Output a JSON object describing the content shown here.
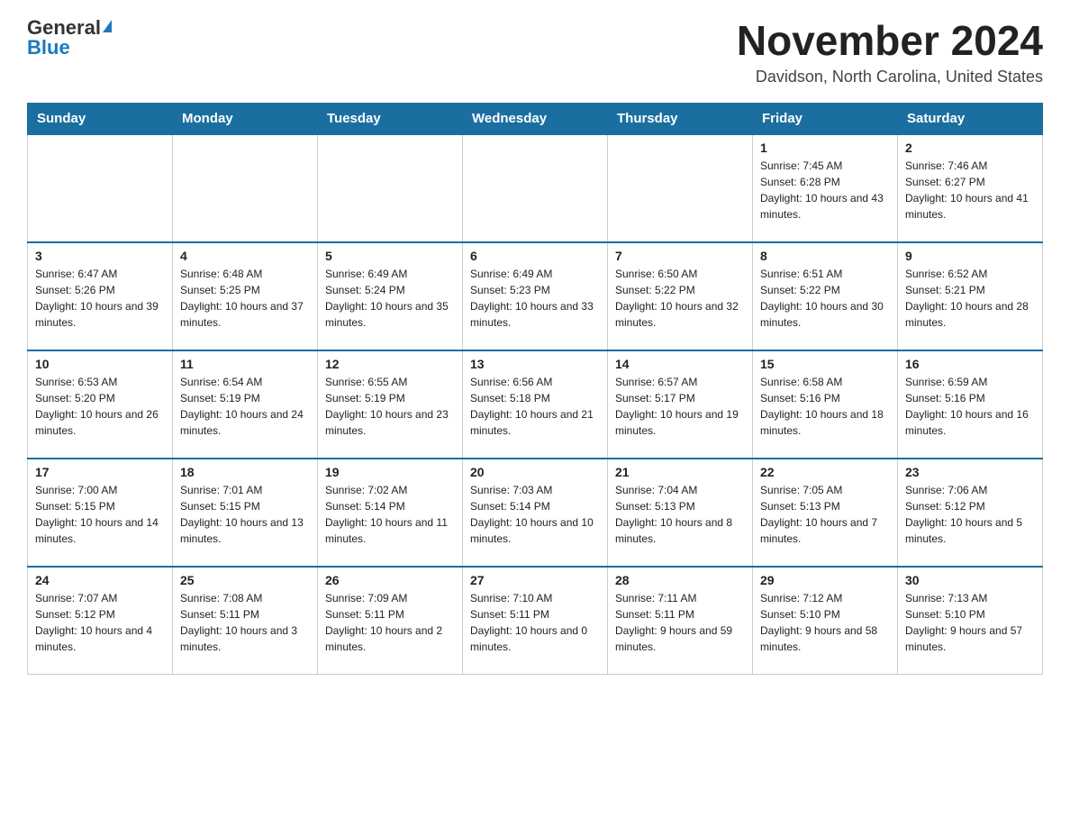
{
  "logo": {
    "general": "General",
    "blue": "Blue"
  },
  "title": {
    "month": "November 2024",
    "location": "Davidson, North Carolina, United States"
  },
  "weekdays": [
    "Sunday",
    "Monday",
    "Tuesday",
    "Wednesday",
    "Thursday",
    "Friday",
    "Saturday"
  ],
  "weeks": [
    [
      {
        "day": "",
        "info": ""
      },
      {
        "day": "",
        "info": ""
      },
      {
        "day": "",
        "info": ""
      },
      {
        "day": "",
        "info": ""
      },
      {
        "day": "",
        "info": ""
      },
      {
        "day": "1",
        "info": "Sunrise: 7:45 AM\nSunset: 6:28 PM\nDaylight: 10 hours and 43 minutes."
      },
      {
        "day": "2",
        "info": "Sunrise: 7:46 AM\nSunset: 6:27 PM\nDaylight: 10 hours and 41 minutes."
      }
    ],
    [
      {
        "day": "3",
        "info": "Sunrise: 6:47 AM\nSunset: 5:26 PM\nDaylight: 10 hours and 39 minutes."
      },
      {
        "day": "4",
        "info": "Sunrise: 6:48 AM\nSunset: 5:25 PM\nDaylight: 10 hours and 37 minutes."
      },
      {
        "day": "5",
        "info": "Sunrise: 6:49 AM\nSunset: 5:24 PM\nDaylight: 10 hours and 35 minutes."
      },
      {
        "day": "6",
        "info": "Sunrise: 6:49 AM\nSunset: 5:23 PM\nDaylight: 10 hours and 33 minutes."
      },
      {
        "day": "7",
        "info": "Sunrise: 6:50 AM\nSunset: 5:22 PM\nDaylight: 10 hours and 32 minutes."
      },
      {
        "day": "8",
        "info": "Sunrise: 6:51 AM\nSunset: 5:22 PM\nDaylight: 10 hours and 30 minutes."
      },
      {
        "day": "9",
        "info": "Sunrise: 6:52 AM\nSunset: 5:21 PM\nDaylight: 10 hours and 28 minutes."
      }
    ],
    [
      {
        "day": "10",
        "info": "Sunrise: 6:53 AM\nSunset: 5:20 PM\nDaylight: 10 hours and 26 minutes."
      },
      {
        "day": "11",
        "info": "Sunrise: 6:54 AM\nSunset: 5:19 PM\nDaylight: 10 hours and 24 minutes."
      },
      {
        "day": "12",
        "info": "Sunrise: 6:55 AM\nSunset: 5:19 PM\nDaylight: 10 hours and 23 minutes."
      },
      {
        "day": "13",
        "info": "Sunrise: 6:56 AM\nSunset: 5:18 PM\nDaylight: 10 hours and 21 minutes."
      },
      {
        "day": "14",
        "info": "Sunrise: 6:57 AM\nSunset: 5:17 PM\nDaylight: 10 hours and 19 minutes."
      },
      {
        "day": "15",
        "info": "Sunrise: 6:58 AM\nSunset: 5:16 PM\nDaylight: 10 hours and 18 minutes."
      },
      {
        "day": "16",
        "info": "Sunrise: 6:59 AM\nSunset: 5:16 PM\nDaylight: 10 hours and 16 minutes."
      }
    ],
    [
      {
        "day": "17",
        "info": "Sunrise: 7:00 AM\nSunset: 5:15 PM\nDaylight: 10 hours and 14 minutes."
      },
      {
        "day": "18",
        "info": "Sunrise: 7:01 AM\nSunset: 5:15 PM\nDaylight: 10 hours and 13 minutes."
      },
      {
        "day": "19",
        "info": "Sunrise: 7:02 AM\nSunset: 5:14 PM\nDaylight: 10 hours and 11 minutes."
      },
      {
        "day": "20",
        "info": "Sunrise: 7:03 AM\nSunset: 5:14 PM\nDaylight: 10 hours and 10 minutes."
      },
      {
        "day": "21",
        "info": "Sunrise: 7:04 AM\nSunset: 5:13 PM\nDaylight: 10 hours and 8 minutes."
      },
      {
        "day": "22",
        "info": "Sunrise: 7:05 AM\nSunset: 5:13 PM\nDaylight: 10 hours and 7 minutes."
      },
      {
        "day": "23",
        "info": "Sunrise: 7:06 AM\nSunset: 5:12 PM\nDaylight: 10 hours and 5 minutes."
      }
    ],
    [
      {
        "day": "24",
        "info": "Sunrise: 7:07 AM\nSunset: 5:12 PM\nDaylight: 10 hours and 4 minutes."
      },
      {
        "day": "25",
        "info": "Sunrise: 7:08 AM\nSunset: 5:11 PM\nDaylight: 10 hours and 3 minutes."
      },
      {
        "day": "26",
        "info": "Sunrise: 7:09 AM\nSunset: 5:11 PM\nDaylight: 10 hours and 2 minutes."
      },
      {
        "day": "27",
        "info": "Sunrise: 7:10 AM\nSunset: 5:11 PM\nDaylight: 10 hours and 0 minutes."
      },
      {
        "day": "28",
        "info": "Sunrise: 7:11 AM\nSunset: 5:11 PM\nDaylight: 9 hours and 59 minutes."
      },
      {
        "day": "29",
        "info": "Sunrise: 7:12 AM\nSunset: 5:10 PM\nDaylight: 9 hours and 58 minutes."
      },
      {
        "day": "30",
        "info": "Sunrise: 7:13 AM\nSunset: 5:10 PM\nDaylight: 9 hours and 57 minutes."
      }
    ]
  ]
}
